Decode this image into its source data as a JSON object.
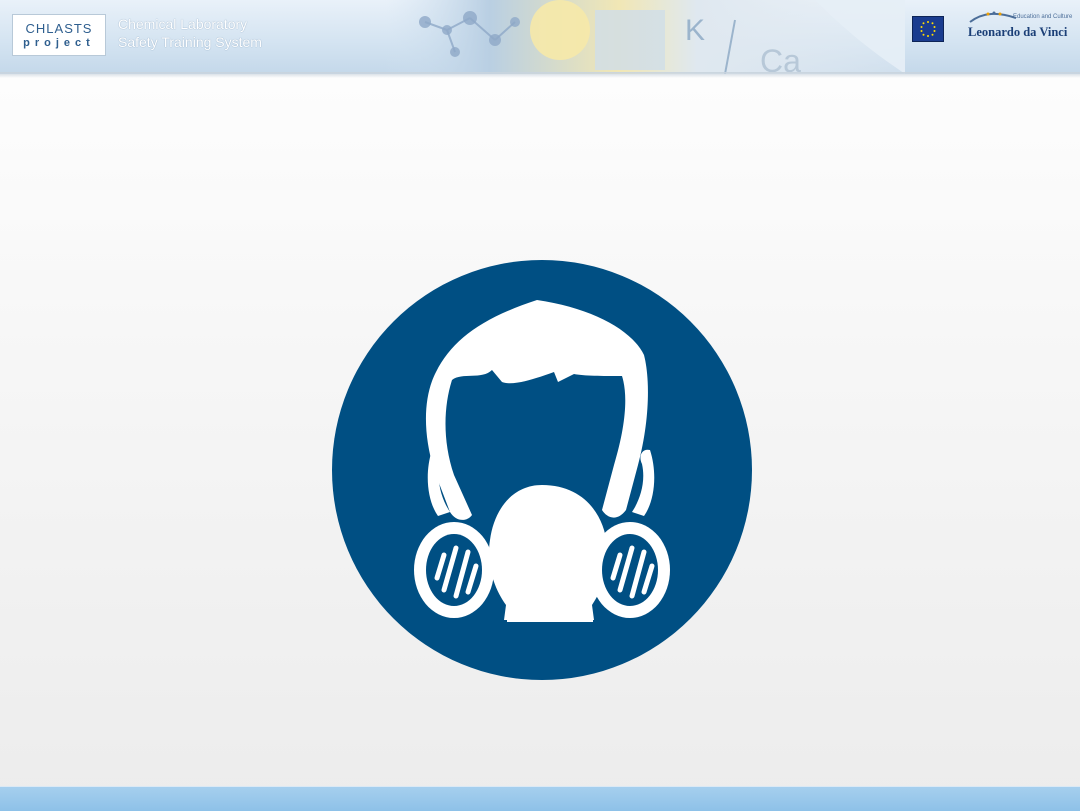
{
  "header": {
    "logo_line1": "CHLASTS",
    "logo_line2": "project",
    "title_line1": "Chemical Laboratory",
    "title_line2": "Safety Training System",
    "program_small": "Education and Culture",
    "program_name": "Leonardo da Vinci"
  },
  "sign": {
    "icon": "respirator-mask-icon",
    "color": "#004f83"
  },
  "colors": {
    "footer": "#97c7ea",
    "header": "#d3e3f1"
  }
}
